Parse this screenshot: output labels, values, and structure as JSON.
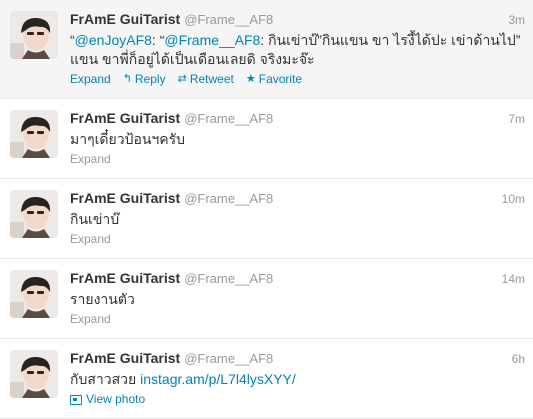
{
  "tweets": [
    {
      "fullname": "FrAmE GuiTarist",
      "username": "@Frame__AF8",
      "time": "3m",
      "text_parts": [
        {
          "t": "“",
          "link": false
        },
        {
          "t": "@enJoyAF8",
          "link": true
        },
        {
          "t": ": “",
          "link": false
        },
        {
          "t": "@Frame__AF8",
          "link": true
        },
        {
          "t": ": กินเข่าบ๊”กินแขน ขา ไรงี้ได้ปะ เข่าด้านไป” แขน ขาพี่ก็อยู่ได้เป็นเดือนเลยดิ จริงมะจ๊ะ",
          "link": false
        }
      ],
      "expand": "Expand",
      "reply": "Reply",
      "retweet": "Retweet",
      "favorite": "Favorite"
    },
    {
      "fullname": "FrAmE GuiTarist",
      "username": "@Frame__AF8",
      "time": "7m",
      "text_parts": [
        {
          "t": "มาๆเดี๋ยวป้อนฯครับ",
          "link": false
        }
      ],
      "expand": "Expand"
    },
    {
      "fullname": "FrAmE GuiTarist",
      "username": "@Frame__AF8",
      "time": "10m",
      "text_parts": [
        {
          "t": "กินเข่าบ๊",
          "link": false
        }
      ],
      "expand": "Expand"
    },
    {
      "fullname": "FrAmE GuiTarist",
      "username": "@Frame__AF8",
      "time": "14m",
      "text_parts": [
        {
          "t": "รายงานตัว",
          "link": false
        }
      ],
      "expand": "Expand"
    },
    {
      "fullname": "FrAmE GuiTarist",
      "username": "@Frame__AF8",
      "time": "6h",
      "text_parts": [
        {
          "t": "กับสาวสวย ",
          "link": false
        },
        {
          "t": "instagr.am/p/L7l4lysXYY/",
          "link": true
        }
      ],
      "view_photo": "View photo"
    }
  ],
  "colors": {
    "link": "#0084b4",
    "muted": "#999999",
    "text": "#333333",
    "hover_bg": "#f5f5f5"
  },
  "icons": {
    "reply": "reply-arrow-icon",
    "retweet": "retweet-icon",
    "favorite": "star-icon",
    "photo": "photo-icon"
  }
}
